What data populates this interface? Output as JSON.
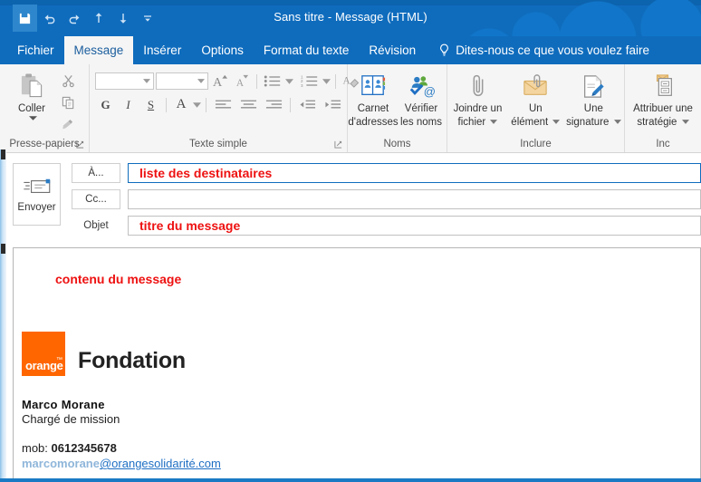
{
  "window": {
    "title": "Sans titre - Message (HTML)"
  },
  "quick_access": {
    "items": [
      {
        "name": "save-icon",
        "label": "Enregistrer"
      },
      {
        "name": "undo-icon",
        "label": "Annuler"
      },
      {
        "name": "redo-icon",
        "label": "Rétablir"
      },
      {
        "name": "up-arrow-icon",
        "label": "Précédent"
      },
      {
        "name": "down-arrow-icon",
        "label": "Suivant"
      },
      {
        "name": "customize-qat-icon",
        "label": "Personnaliser la barre d'outils Accès rapide"
      }
    ]
  },
  "tabs": [
    {
      "label": "Fichier",
      "active": false
    },
    {
      "label": "Message",
      "active": true
    },
    {
      "label": "Insérer",
      "active": false
    },
    {
      "label": "Options",
      "active": false
    },
    {
      "label": "Format du texte",
      "active": false
    },
    {
      "label": "Révision",
      "active": false
    }
  ],
  "tell_me": {
    "label": "Dites-nous ce que vous voulez faire",
    "icon": "lightbulb-icon"
  },
  "ribbon": {
    "groups": [
      {
        "id": "clipboard",
        "label": "Presse-papiers",
        "has_dialog_launcher": true,
        "paste_label": "Coller",
        "commands": [
          {
            "label": "Couper",
            "icon": "scissors-icon"
          },
          {
            "label": "Copier",
            "icon": "copy-icon"
          },
          {
            "label": "Reproduire la mise en forme",
            "icon": "format-painter-icon"
          }
        ]
      },
      {
        "id": "basic_text",
        "label": "Texte simple",
        "has_dialog_launcher": true,
        "font_name": "",
        "font_size": "",
        "commands": [
          {
            "label": "Augmenter la taille de police",
            "icon": "grow-font-icon"
          },
          {
            "label": "Réduire la taille de police",
            "icon": "shrink-font-icon"
          },
          {
            "label": "Puces",
            "icon": "bullets-icon"
          },
          {
            "label": "Numérotation",
            "icon": "numbering-icon"
          },
          {
            "label": "Effacer toute la mise en forme",
            "icon": "clear-formatting-icon"
          },
          {
            "label": "G",
            "icon": "bold-icon"
          },
          {
            "label": "I",
            "icon": "italic-icon"
          },
          {
            "label": "S",
            "icon": "underline-icon"
          },
          {
            "label": "Couleur de police",
            "icon": "font-color-icon"
          },
          {
            "label": "Aligner à gauche",
            "icon": "align-left-icon"
          },
          {
            "label": "Centrer",
            "icon": "align-center-icon"
          },
          {
            "label": "Aligner à droite",
            "icon": "align-right-icon"
          },
          {
            "label": "Diminuer le retrait",
            "icon": "decrease-indent-icon"
          },
          {
            "label": "Augmenter le retrait",
            "icon": "increase-indent-icon"
          }
        ]
      },
      {
        "id": "names",
        "label": "Noms",
        "has_dialog_launcher": false,
        "buttons": [
          {
            "label": "Carnet\nd'adresses",
            "line1": "Carnet",
            "line2": "d'adresses",
            "icon": "address-book-icon"
          },
          {
            "label": "Vérifier\nles noms",
            "line1": "Vérifier",
            "line2": "les noms",
            "icon": "check-names-icon"
          }
        ]
      },
      {
        "id": "include",
        "label": "Inclure",
        "has_dialog_launcher": false,
        "buttons": [
          {
            "line1": "Joindre un",
            "line2": "fichier",
            "icon": "paperclip-icon",
            "has_caret": true
          },
          {
            "line1": "Un",
            "line2": "élément",
            "icon": "attach-item-icon",
            "has_caret": true
          },
          {
            "line1": "Une",
            "line2": "signature",
            "icon": "signature-icon",
            "has_caret": true
          }
        ]
      },
      {
        "id": "tags",
        "label": "Inc",
        "has_dialog_launcher": false,
        "buttons": [
          {
            "line1": "Attribuer une",
            "line2": "stratégie",
            "icon": "assign-policy-icon",
            "has_caret": true
          }
        ]
      }
    ]
  },
  "compose": {
    "send_button": {
      "label": "Envoyer",
      "icon": "send-envelope-icon"
    },
    "fields": [
      {
        "id": "to",
        "button_label": "À...",
        "is_button": true,
        "value": "liste des destinataires",
        "focused": true
      },
      {
        "id": "cc",
        "button_label": "Cc...",
        "is_button": true,
        "value": "",
        "focused": false
      },
      {
        "id": "subject",
        "button_label": "Objet",
        "is_button": false,
        "value": "titre du message",
        "focused": false
      }
    ]
  },
  "message_body": {
    "annotation": "contenu du message",
    "signature": {
      "logo_word": "orange",
      "logo_tm": "™",
      "brand": "Fondation",
      "name": "Marco Morane",
      "role": "Chargé de mission",
      "mobile_label": "mob:",
      "mobile_number": "0612345678",
      "email_local": "marcomorane",
      "email_domain": "@orangesolidarité.com"
    }
  },
  "colors": {
    "title_bar": "#0f6cbd",
    "ribbon_bg": "#f5f5f5",
    "annotation_red": "#ee1111",
    "orange_brand": "#ff6600",
    "focus_blue": "#0f6cbd",
    "link_blue": "#1f6fc4"
  }
}
